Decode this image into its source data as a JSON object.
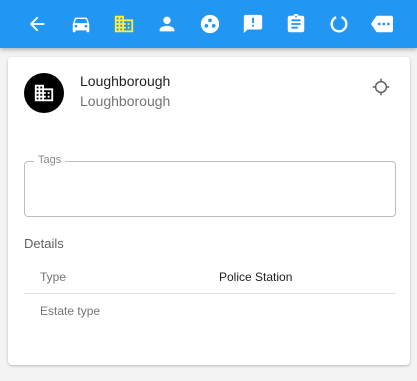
{
  "toolbar": {
    "bg_color": "#2196f3",
    "active_color": "#ffeb3b",
    "icons": [
      "back-arrow-icon",
      "car-icon",
      "building-icon",
      "person-icon",
      "group-icon",
      "report-icon",
      "clipboard-icon",
      "loading-icon",
      "more-icon"
    ]
  },
  "location": {
    "title": "Loughborough",
    "subtitle": "Loughborough"
  },
  "tags": {
    "label": "Tags",
    "value": ""
  },
  "details": {
    "heading": "Details",
    "rows": [
      {
        "key": "Type",
        "value": "Police Station"
      },
      {
        "key": "Estate type",
        "value": ""
      }
    ]
  }
}
